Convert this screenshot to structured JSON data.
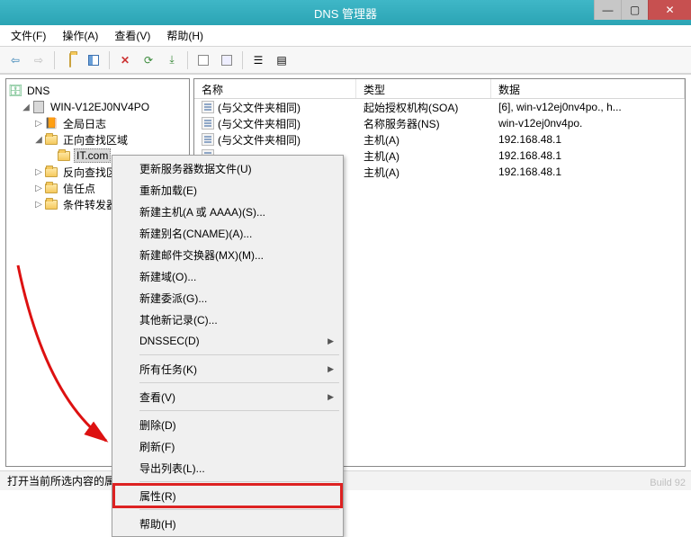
{
  "window": {
    "title": "DNS 管理器"
  },
  "menubar": [
    "文件(F)",
    "操作(A)",
    "查看(V)",
    "帮助(H)"
  ],
  "tree": {
    "root": "DNS",
    "server": "WIN-V12EJ0NV4PO",
    "globalLog": "全局日志",
    "fwdZone": "正向查找区域",
    "zone": "IT.com",
    "revZone": "反向查找区域",
    "trust": "信任点",
    "cond": "条件转发器"
  },
  "cols": [
    "名称",
    "类型",
    "数据"
  ],
  "rows": [
    {
      "name": "(与父文件夹相同)",
      "type": "起始授权机构(SOA)",
      "data": "[6], win-v12ej0nv4po., h..."
    },
    {
      "name": "(与父文件夹相同)",
      "type": "名称服务器(NS)",
      "data": "win-v12ej0nv4po."
    },
    {
      "name": "(与父文件夹相同)",
      "type": "主机(A)",
      "data": "192.168.48.1"
    },
    {
      "name": "",
      "type": "主机(A)",
      "data": "192.168.48.1"
    },
    {
      "name": "",
      "type": "主机(A)",
      "data": "192.168.48.1"
    }
  ],
  "context": {
    "updateServer": "更新服务器数据文件(U)",
    "reload": "重新加载(E)",
    "newHost": "新建主机(A 或 AAAA)(S)...",
    "newCname": "新建别名(CNAME)(A)...",
    "newMx": "新建邮件交换器(MX)(M)...",
    "newDomain": "新建域(O)...",
    "newDeleg": "新建委派(G)...",
    "otherNew": "其他新记录(C)...",
    "dnssec": "DNSSEC(D)",
    "allTasks": "所有任务(K)",
    "view": "查看(V)",
    "delete": "删除(D)",
    "refresh": "刷新(F)",
    "exportList": "导出列表(L)...",
    "properties": "属性(R)",
    "help": "帮助(H)"
  },
  "status": "打开当前所选内容的属性对话框。",
  "build": "Build 92"
}
